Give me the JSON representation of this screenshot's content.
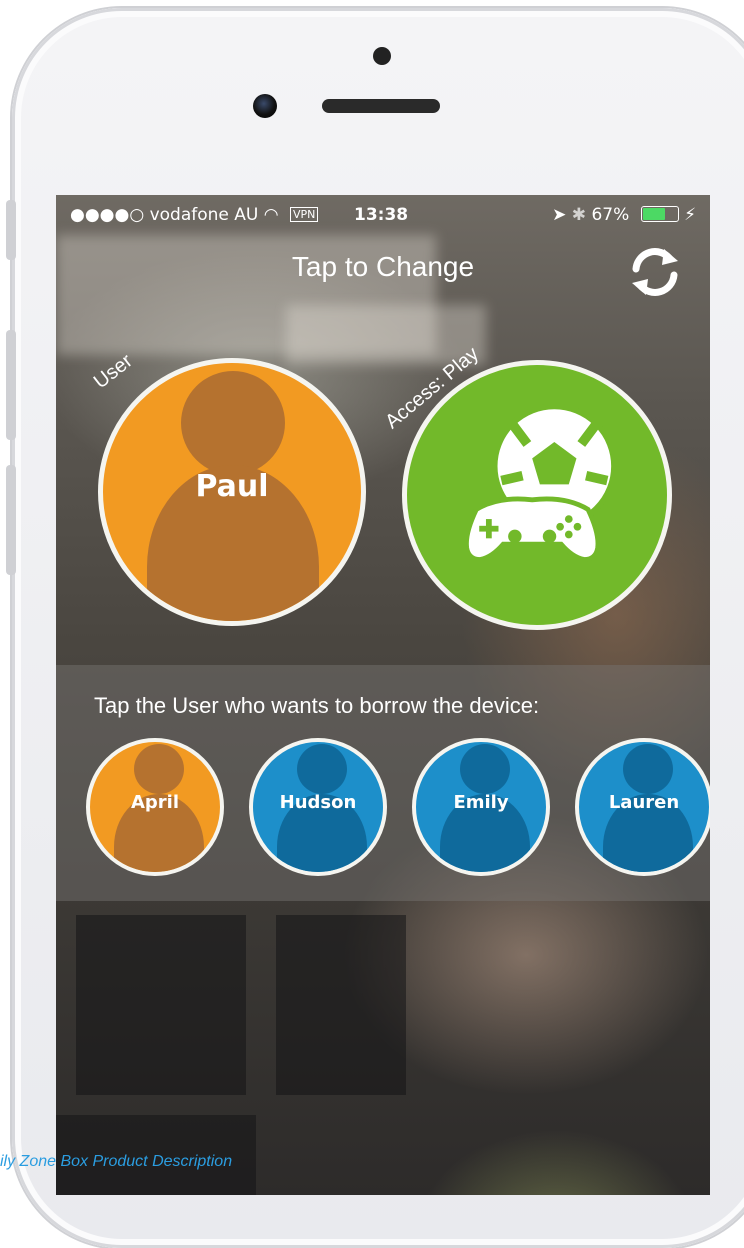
{
  "status_bar": {
    "carrier": "●●●●○ vodafone AU",
    "vpn": "VPN",
    "time": "13:38",
    "battery_percent": "67%",
    "battery_level": 0.67,
    "battery_color": "#4cd964"
  },
  "header": {
    "title": "Tap to Change",
    "refresh_icon": "refresh-icon"
  },
  "current_user": {
    "label": "User",
    "name": "Paul",
    "color": "#f29a22"
  },
  "access": {
    "label": "Access: Play",
    "icon": "game-controller-soccer-ball-icon",
    "color": "#72b92a"
  },
  "borrow_panel": {
    "prompt": "Tap the User who wants to borrow the device:",
    "users": [
      {
        "name": "April",
        "color": "#f29a22"
      },
      {
        "name": "Hudson",
        "color": "#1d8fca"
      },
      {
        "name": "Emily",
        "color": "#1d8fca"
      },
      {
        "name": "Lauren",
        "color": "#1d8fca"
      }
    ]
  },
  "caption": "ily Zone Box Product Description"
}
